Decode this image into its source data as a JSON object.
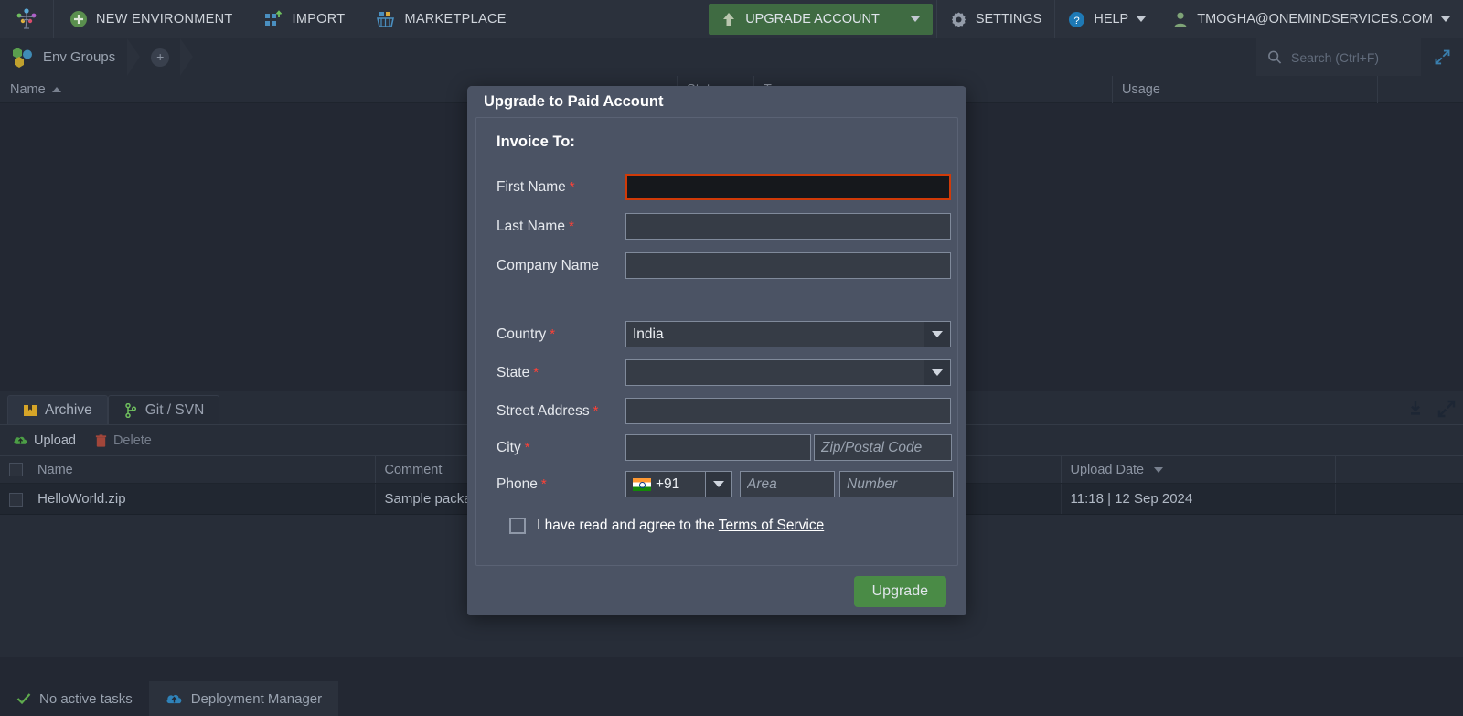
{
  "topbar": {
    "logo_icon": "jelastic-logo-icon",
    "items": [
      {
        "label": "NEW ENVIRONMENT",
        "icon": "plus-circle-icon"
      },
      {
        "label": "IMPORT",
        "icon": "import-icon"
      },
      {
        "label": "MARKETPLACE",
        "icon": "marketplace-basket-icon"
      }
    ],
    "upgrade": {
      "label": "UPGRADE ACCOUNT",
      "icon": "up-arrow-icon",
      "caret": "chevron-down-icon",
      "color": "#3f6b42"
    },
    "settings": {
      "label": "SETTINGS",
      "icon": "gear-icon"
    },
    "help": {
      "label": "HELP",
      "icon": "question-circle-icon",
      "caret": "chevron-down-icon"
    },
    "account": {
      "label": "TMOGHA@ONEMINDSERVICES.COM",
      "icon": "user-icon",
      "caret": "chevron-down-icon"
    }
  },
  "breadcrumb": {
    "root_label": "Env Groups",
    "root_icon": "env-groups-icon",
    "add_label": "+",
    "search": {
      "placeholder": "Search (Ctrl+F)",
      "value": "",
      "icon": "search-icon"
    },
    "expand_icon": "expand-diagonal-icon"
  },
  "env_table": {
    "columns": [
      {
        "label": "Name",
        "sort": "asc"
      },
      {
        "label": "Status"
      },
      {
        "label": "Tags"
      },
      {
        "label": "Usage"
      }
    ]
  },
  "archive": {
    "tabs": [
      {
        "label": "Archive",
        "icon": "archive-box-icon",
        "active": true
      },
      {
        "label": "Git / SVN",
        "icon": "git-branch-icon",
        "active": false
      }
    ],
    "tools": [
      {
        "icon": "download-icon"
      },
      {
        "icon": "expand-diagonal-icon"
      }
    ],
    "toolbar": [
      {
        "label": "Upload",
        "icon": "upload-cloud-icon",
        "enabled": true
      },
      {
        "label": "Delete",
        "icon": "trash-icon",
        "enabled": false
      }
    ],
    "columns": [
      "Name",
      "Comment",
      "Upload Date",
      ""
    ],
    "sort_column": "Upload Date",
    "rows": [
      {
        "name": "HelloWorld.zip",
        "comment": "Sample packa",
        "upload_date": "11:18 | 12 Sep 2024"
      }
    ]
  },
  "statusbar": {
    "tasks": {
      "label": "No active tasks",
      "icon": "check-icon"
    },
    "deployment": {
      "label": "Deployment Manager",
      "icon": "cloud-icon"
    }
  },
  "modal": {
    "title": "Upgrade to Paid Account",
    "section_title": "Invoice To:",
    "fields": {
      "first_name": {
        "label": "First Name",
        "required": "*",
        "value": "",
        "focused": true
      },
      "last_name": {
        "label": "Last Name",
        "required": "*",
        "value": ""
      },
      "company_name": {
        "label": "Company Name",
        "required": "",
        "value": ""
      },
      "country": {
        "label": "Country",
        "required": "*",
        "value": "India"
      },
      "state": {
        "label": "State",
        "required": "*",
        "value": ""
      },
      "street_address": {
        "label": "Street Address",
        "required": "*",
        "value": ""
      },
      "city": {
        "label": "City",
        "required": "*",
        "value": ""
      },
      "zip": {
        "placeholder": "Zip/Postal Code",
        "value": ""
      },
      "phone": {
        "label": "Phone",
        "required": "*",
        "code": "+91",
        "flag": "india-flag-icon"
      },
      "phone_area": {
        "placeholder": "Area",
        "value": ""
      },
      "phone_number": {
        "placeholder": "Number",
        "value": ""
      }
    },
    "terms": {
      "text_before": "I have read and agree to the",
      "link_label": "Terms of Service",
      "checked": false
    },
    "submit_label": "Upgrade",
    "accent_focus": "#d03a08",
    "accent_green": "#4a8b46"
  }
}
